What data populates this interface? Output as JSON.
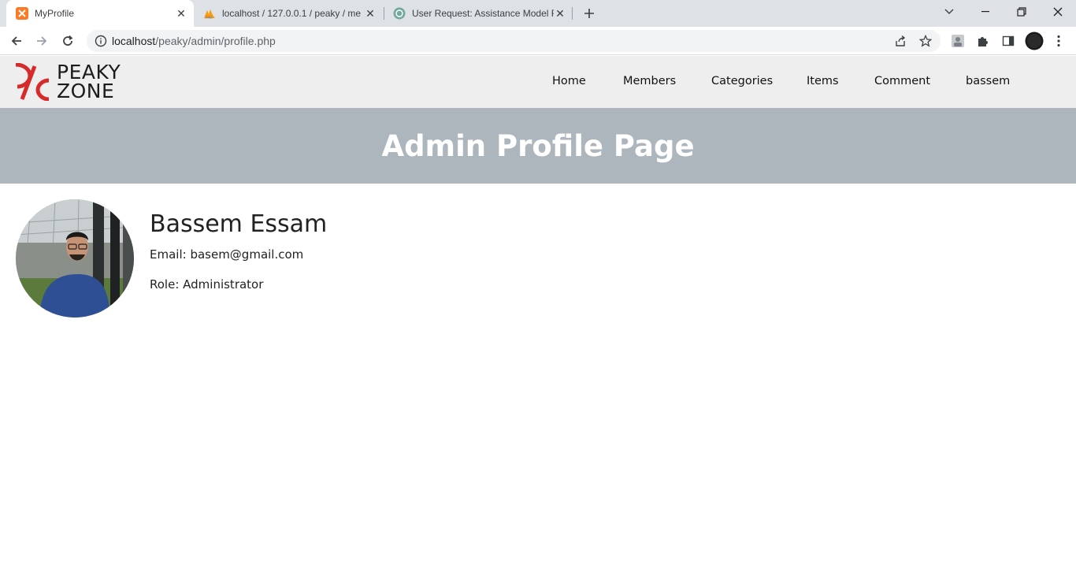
{
  "browser": {
    "tabs": [
      {
        "title": "MyProfile",
        "favicon": "xampp-icon",
        "active": true
      },
      {
        "title": "localhost / 127.0.0.1 / peaky / me",
        "favicon": "phpmyadmin-icon",
        "active": false
      },
      {
        "title": "User Request: Assistance Model F",
        "favicon": "chatgpt-icon",
        "active": false
      }
    ],
    "url_host": "localhost",
    "url_path": "/peaky/admin/profile.php"
  },
  "site": {
    "logo_line1": "PEAKY",
    "logo_line2": "ZONE",
    "logo_color": "#d62b2b",
    "nav": [
      "Home",
      "Members",
      "Categories",
      "Items",
      "Comment",
      "bassem"
    ]
  },
  "banner": {
    "title": "Admin Profile Page",
    "bg_color": "#adb5bd"
  },
  "profile": {
    "name": "Bassem Essam",
    "email_line": "Email: basem@gmail.com",
    "role_line": "Role: Administrator"
  }
}
